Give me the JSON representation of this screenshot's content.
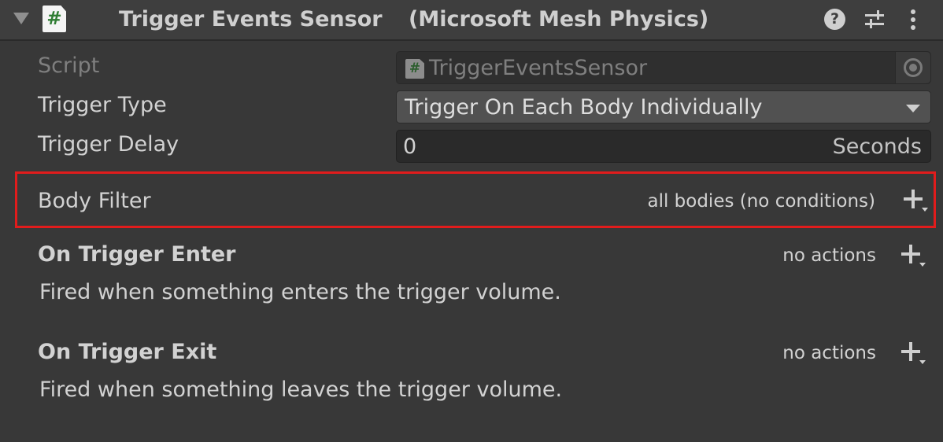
{
  "component": {
    "title": "Trigger Events Sensor",
    "subtitle": "(Microsoft Mesh Physics)",
    "icons": {
      "foldout": "foldout-expanded-triangle",
      "script": "csharp-script-hash-icon",
      "help": "question-mark-circle",
      "presets": "sliders-presets",
      "menu": "vertical-ellipsis"
    },
    "script_icon_glyph": "#"
  },
  "fields": {
    "script": {
      "label": "Script",
      "value": "TriggerEventsSensor",
      "icon_glyph": "#"
    },
    "trigger_type": {
      "label": "Trigger Type",
      "value": "Trigger On Each Body Individually"
    },
    "trigger_delay": {
      "label": "Trigger Delay",
      "value": "0",
      "unit": "Seconds"
    }
  },
  "body_filter": {
    "label": "Body Filter",
    "summary": "all bodies (no conditions)",
    "highlight_color": "#e11c1c"
  },
  "events": [
    {
      "title": "On Trigger Enter",
      "summary": "no actions",
      "description": "Fired when something enters the trigger volume."
    },
    {
      "title": "On Trigger Exit",
      "summary": "no actions",
      "description": "Fired when something leaves the trigger volume."
    }
  ],
  "colors": {
    "background": "#383838",
    "header": "#3e3e3e",
    "text": "#d2d2d2",
    "disabled_text": "#7f7f7f",
    "script_hash": "#2f7d33"
  }
}
